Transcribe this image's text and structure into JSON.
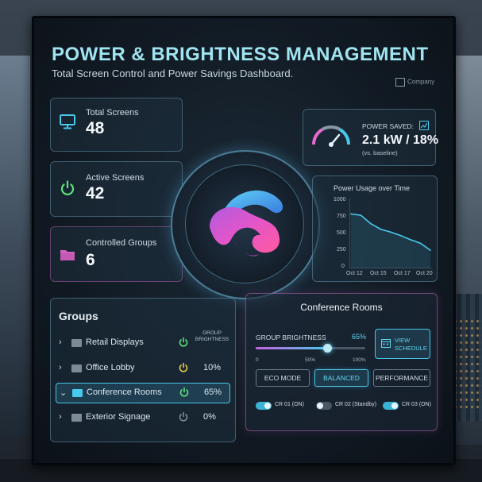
{
  "header": {
    "title": "POWER & BRIGHTNESS MANAGEMENT",
    "subtitle": "Total Screen Control and Power Savings Dashboard.",
    "company": "Company"
  },
  "stats": [
    {
      "label": "Total Screens",
      "value": "48",
      "icon": "monitor-icon",
      "color": "#49c9ee"
    },
    {
      "label": "Active Screens",
      "value": "42",
      "icon": "power-icon",
      "color": "#5fe07a"
    },
    {
      "label": "Controlled Groups",
      "value": "6",
      "icon": "folder-icon",
      "color": "#e46ad0"
    }
  ],
  "power_saved": {
    "label": "POWER SAVED:",
    "value": "2.1 kW / 18%",
    "note": "(vs. baseline)"
  },
  "usage_chart": {
    "title": "Power Usage over Time",
    "y_ticks": [
      "1000",
      "750",
      "500",
      "250",
      "0"
    ],
    "x_ticks": [
      "Oct 12",
      "Oct 15",
      "Oct 17",
      "Oct 20"
    ]
  },
  "chart_data": {
    "type": "line",
    "title": "Power Usage over Time",
    "x": [
      "Oct 12",
      "Oct 13",
      "Oct 14",
      "Oct 15",
      "Oct 16",
      "Oct 17",
      "Oct 18",
      "Oct 19",
      "Oct 20"
    ],
    "values": [
      780,
      760,
      640,
      560,
      520,
      470,
      410,
      360,
      260
    ],
    "ylim": [
      0,
      1000
    ],
    "y_ticks": [
      1000,
      750,
      500,
      250,
      0
    ],
    "x_ticks": [
      "Oct 12",
      "Oct 15",
      "Oct 17",
      "Oct 20"
    ],
    "grid": false
  },
  "groups": {
    "heading": "Groups",
    "column_header": "GROUP BRIGHTNESS",
    "items": [
      {
        "name": "Retail Displays",
        "pct": "",
        "power_color": "#5fe07a",
        "folder_color": "#7d8b97",
        "selected": false
      },
      {
        "name": "Office Lobby",
        "pct": "10%",
        "power_color": "#e8c94a",
        "folder_color": "#7d8b97",
        "selected": false
      },
      {
        "name": "Conference Rooms",
        "pct": "65%",
        "power_color": "#5fe07a",
        "folder_color": "#49c9ee",
        "selected": true
      },
      {
        "name": "Exterior Signage",
        "pct": "0%",
        "power_color": "#7d8b97",
        "folder_color": "#7d8b97",
        "selected": false
      }
    ]
  },
  "conference": {
    "title": "Conference Rooms",
    "brightness_label": "GROUP BRIGHTNESS",
    "brightness_pct": "65%",
    "brightness_value": 0.65,
    "ticks": [
      "0",
      "50%",
      "100%"
    ],
    "view_schedule": "VIEW SCHEDULE",
    "modes": [
      "ECO MODE",
      "BALANCED",
      "PERFORMANCE"
    ],
    "active_mode": "BALANCED",
    "toggles": [
      {
        "label": "CR 01 (ON)",
        "on": true
      },
      {
        "label": "CR 02 (Standby)",
        "on": false
      },
      {
        "label": "CR 03 (ON)",
        "on": true
      }
    ]
  }
}
